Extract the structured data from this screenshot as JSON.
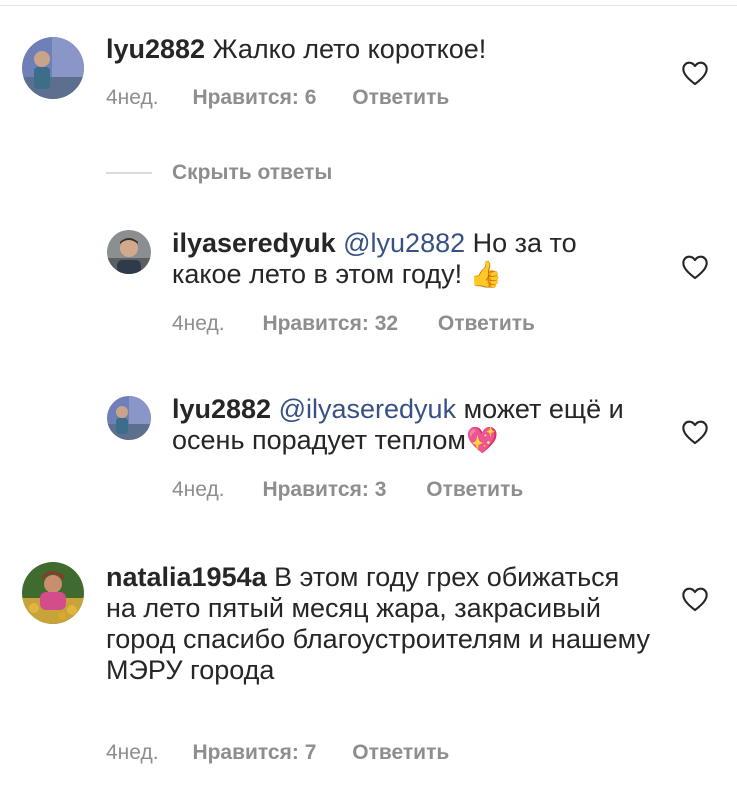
{
  "colors": {
    "text": "#262626",
    "secondary": "#8e8e8e",
    "mention": "#385185",
    "divider": "#dbdbdb"
  },
  "hide_replies_label": "Скрыть ответы",
  "comments": [
    {
      "username": "lyu2882",
      "mention": "",
      "text": "Жалко лето короткое!",
      "emoji": "",
      "time": "4нед.",
      "likes": "Нравится: 6",
      "reply": "Ответить",
      "icon": "heart-outline-icon"
    },
    {
      "username": "ilyaseredyuk",
      "mention": "@lyu2882",
      "text": "Но за то какое лето в этом году!",
      "emoji": "👍",
      "time": "4нед.",
      "likes": "Нравится: 32",
      "reply": "Ответить",
      "icon": "heart-outline-icon"
    },
    {
      "username": "lyu2882",
      "mention": "@ilyaseredyuk",
      "text": "может ещё и осень порадует теплом",
      "emoji": "💖",
      "time": "4нед.",
      "likes": "Нравится: 3",
      "reply": "Ответить",
      "icon": "heart-outline-icon"
    },
    {
      "username": "natalia1954a",
      "mention": "",
      "text": "В этом году грех обижаться на лето пятый месяц жара, закрасивый город спасибо благоустроителям и нашему МЭРУ города",
      "emoji": "",
      "time": "4нед.",
      "likes": "Нравится: 7",
      "reply": "Ответить",
      "icon": "heart-outline-icon"
    }
  ]
}
